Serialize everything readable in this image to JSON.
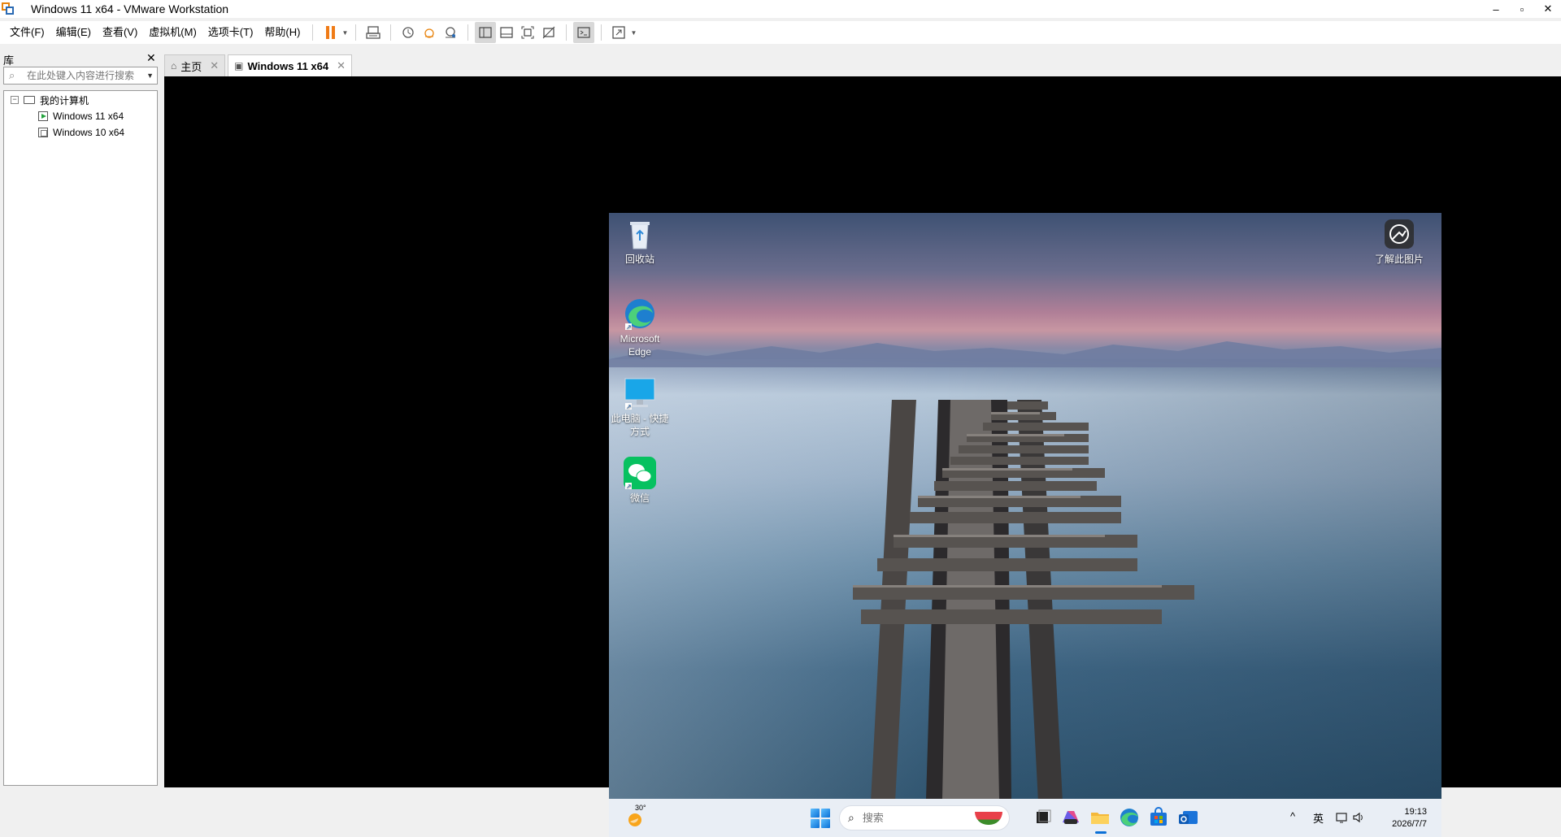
{
  "window": {
    "title": "Windows 11 x64 - VMware Workstation",
    "minimize": "–",
    "maximize": "▫",
    "close": "✕"
  },
  "menu": [
    "文件(F)",
    "编辑(E)",
    "查看(V)",
    "虚拟机(M)",
    "选项卡(T)",
    "帮助(H)"
  ],
  "toolbar": {
    "icons": [
      "pause-icon",
      "send-ctrl-alt-del-icon",
      "snapshot-icon",
      "revert-snapshot-icon",
      "snapshot-manager-icon",
      "show-library-icon",
      "thumbnail-bar-icon",
      "full-screen-icon",
      "unity-icon",
      "console-view-icon",
      "stretch-guest-icon"
    ]
  },
  "library": {
    "title": "库",
    "close": "✕",
    "search_placeholder": "在此处键入内容进行搜索",
    "tree": {
      "root": "我的计算机",
      "items": [
        "Windows 11 x64",
        "Windows 10 x64"
      ]
    }
  },
  "tabs": [
    {
      "label": "主页"
    },
    {
      "label": "Windows 11 x64"
    }
  ],
  "tab_close": "✕",
  "desktop": {
    "icons": [
      {
        "label": "回收站"
      },
      {
        "label": "Microsoft Edge"
      },
      {
        "label": "此电脑 - 快捷方式"
      },
      {
        "label": "微信"
      },
      {
        "label": "了解此图片"
      }
    ]
  },
  "taskbar": {
    "weather_temp": "30°",
    "search_placeholder": "搜索",
    "tray": {
      "chevron": "^",
      "ime": "英",
      "time": "19:13",
      "date": "2026/7/7"
    }
  },
  "colors": {
    "pause": "#f07b16",
    "taskbar": "#e9eef5",
    "wechat": "#07c160",
    "windows_blue": "#0a6fd6"
  }
}
